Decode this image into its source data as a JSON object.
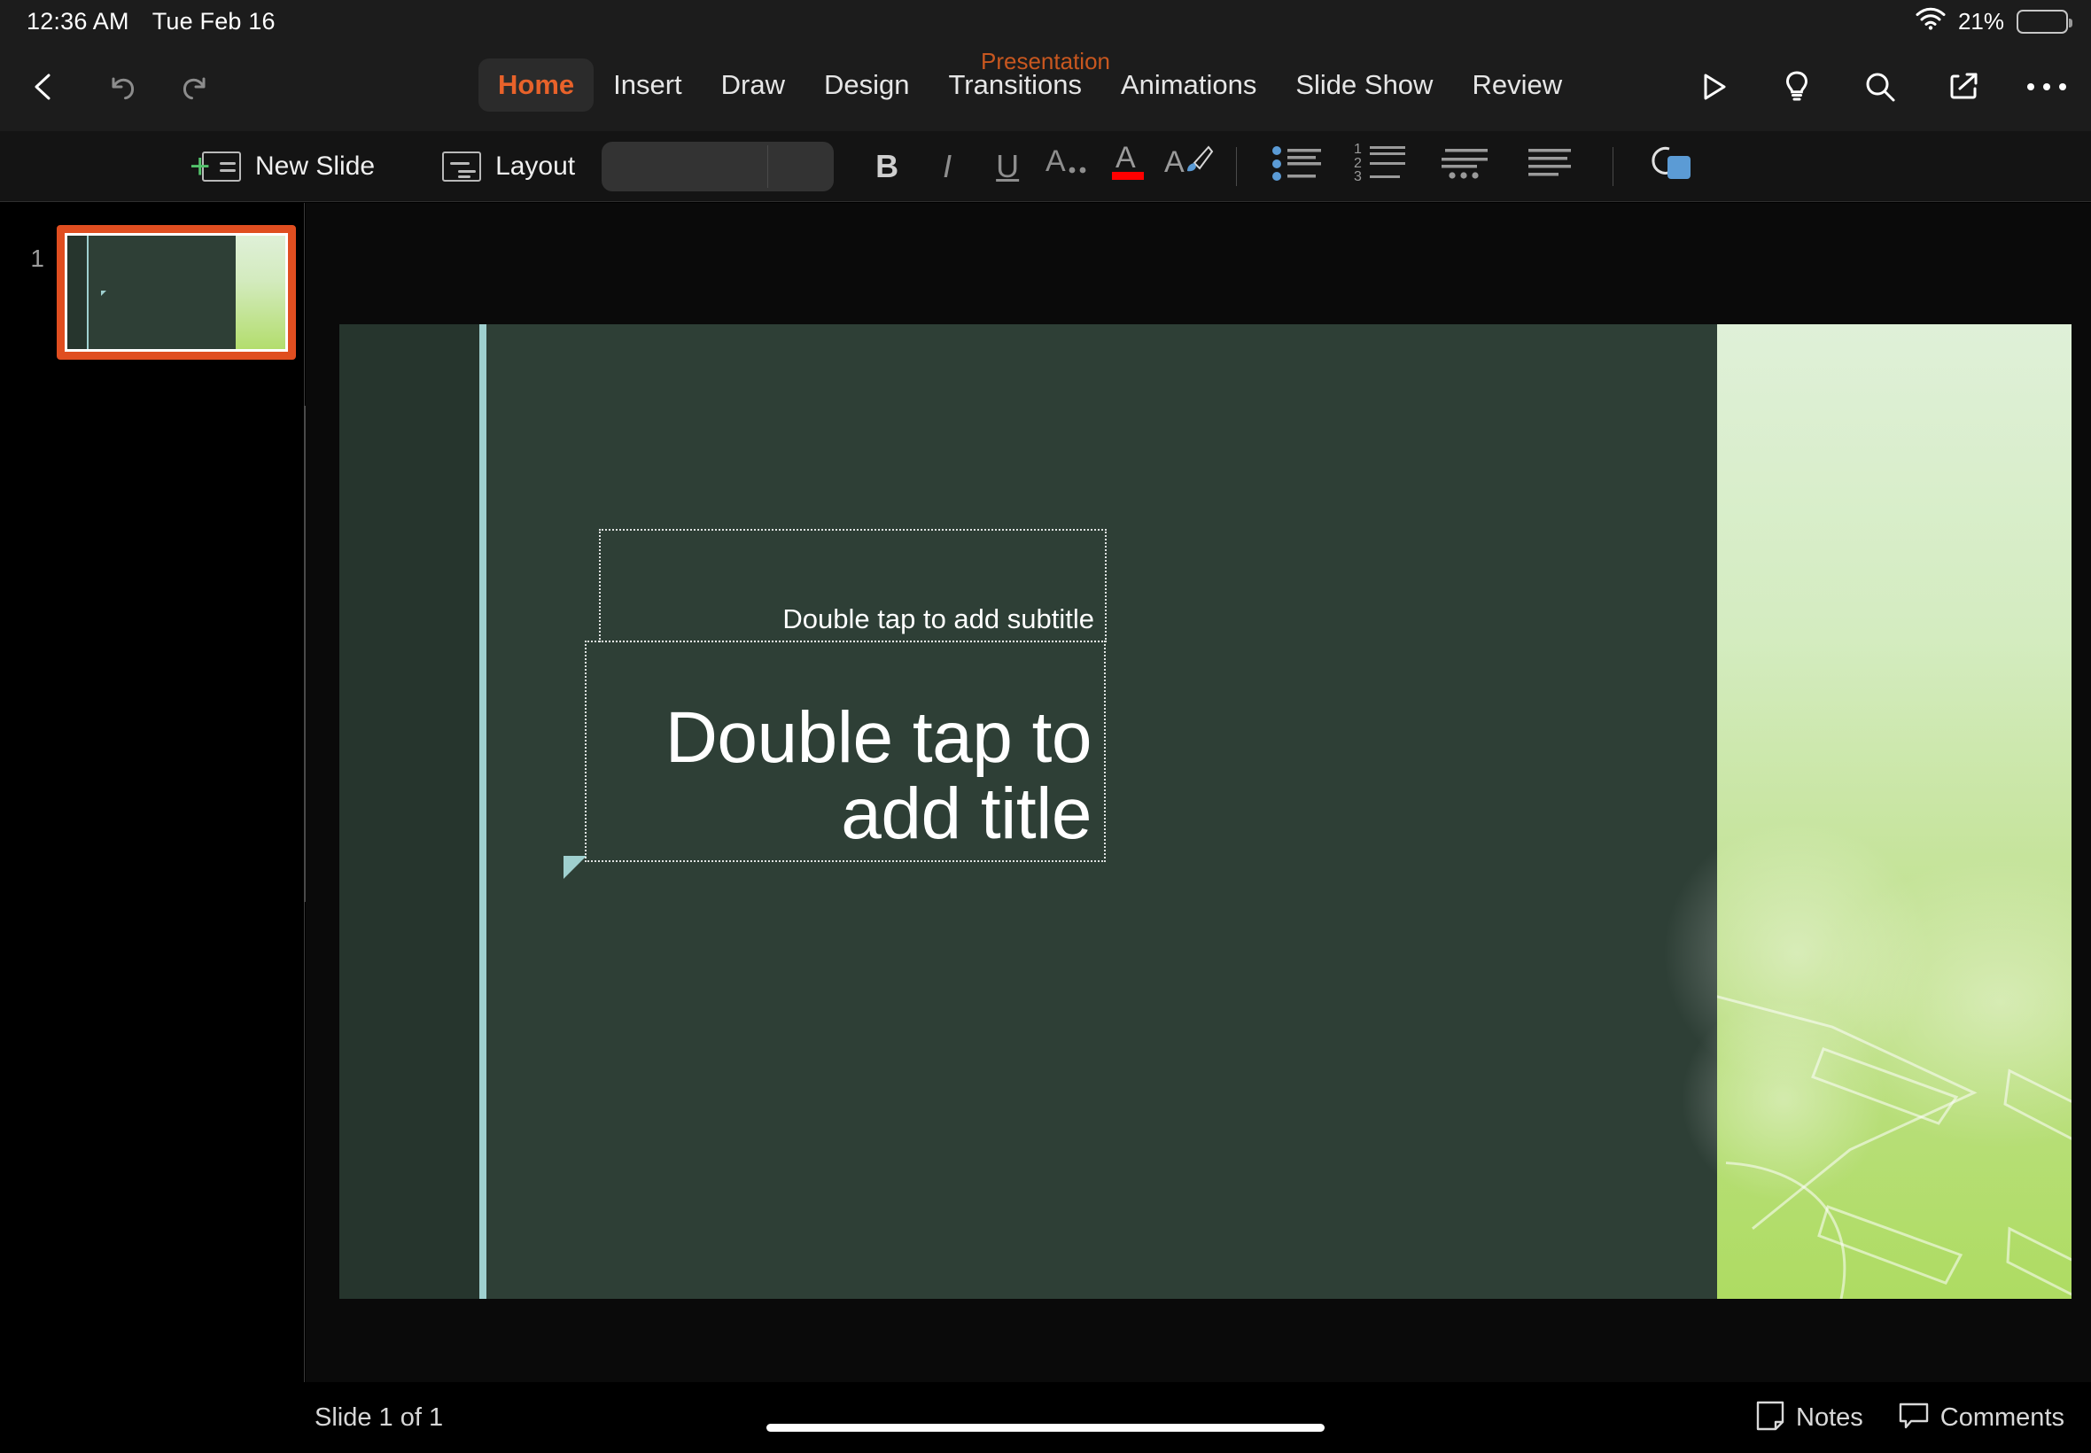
{
  "status_bar": {
    "time": "12:36 AM",
    "date": "Tue Feb 16",
    "wifi_icon": "wifi-icon",
    "battery_percent": "21%",
    "battery_level": 21
  },
  "header": {
    "document_title": "Presentation",
    "back_icon": "back-chevron-icon",
    "undo_icon": "undo-icon",
    "redo_icon": "redo-icon",
    "tabs": [
      {
        "label": "Home",
        "active": true
      },
      {
        "label": "Insert",
        "active": false
      },
      {
        "label": "Draw",
        "active": false
      },
      {
        "label": "Design",
        "active": false
      },
      {
        "label": "Transitions",
        "active": false
      },
      {
        "label": "Animations",
        "active": false
      },
      {
        "label": "Slide Show",
        "active": false
      },
      {
        "label": "Review",
        "active": false
      }
    ],
    "actions": [
      {
        "name": "play-slideshow-icon"
      },
      {
        "name": "lightbulb-icon"
      },
      {
        "name": "search-icon"
      },
      {
        "name": "share-icon"
      },
      {
        "name": "more-ellipsis-icon"
      }
    ]
  },
  "ribbon": {
    "new_slide_label": "New Slide",
    "layout_label": "Layout",
    "font_field_value": "",
    "font_field_placeholder": "",
    "bold_label": "B",
    "italic_label": "I",
    "underline_label": "U",
    "more_format_label": "A",
    "font_color_label": "A",
    "font_color_swatch": "#ff0000",
    "highlight_label": "A",
    "bullets_icon": "bulleted-list-icon",
    "numbering_icon": "numbered-list-icon",
    "indent_icon": "indent-icon",
    "align_icon": "align-left-icon",
    "shape_icon": "shape-arrange-icon",
    "accent_blue": "#5b9bd5",
    "accent_green": "#53c26b"
  },
  "sidebar": {
    "slides": [
      {
        "number": "1",
        "selected": true
      }
    ],
    "selection_color": "#e04e20"
  },
  "slide": {
    "subtitle_placeholder": "Double tap to add subtitle",
    "title_placeholder": "Double tap to add title",
    "background_color": "#2e3f36",
    "accent_teal": "#9fd0cf",
    "panel_gradient_top": "#dff0d8",
    "panel_gradient_bottom": "#aedc62"
  },
  "bottom_bar": {
    "slide_count": "Slide 1 of 1",
    "notes_label": "Notes",
    "notes_icon": "notes-page-icon",
    "comments_label": "Comments",
    "comments_icon": "comment-bubble-icon"
  }
}
